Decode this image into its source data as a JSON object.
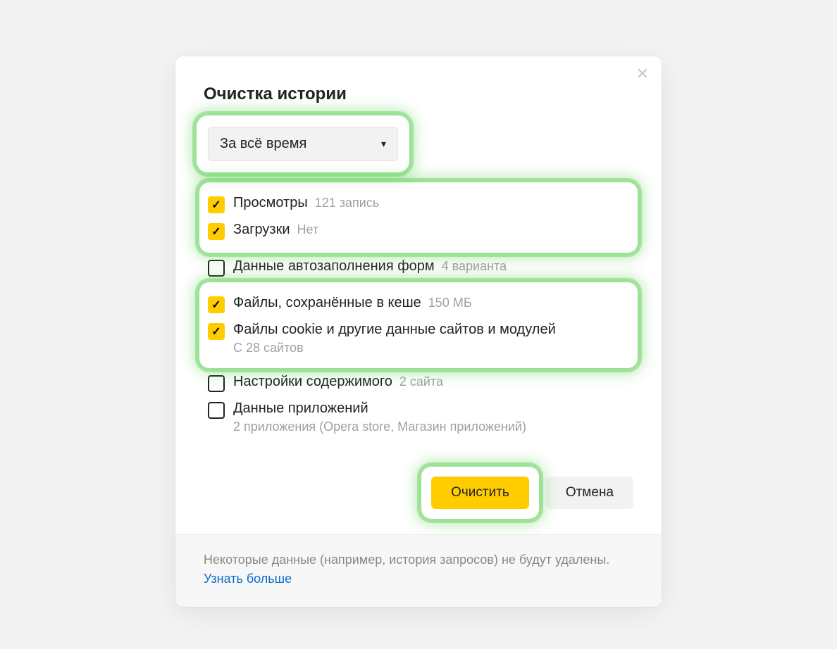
{
  "dialog": {
    "title": "Очистка истории",
    "time_range_selected": "За всё время",
    "options": {
      "history": {
        "label": "Просмотры",
        "sub": "121 запись",
        "checked": true
      },
      "downloads": {
        "label": "Загрузки",
        "sub": "Нет",
        "checked": true
      },
      "autofill": {
        "label": "Данные автозаполнения форм",
        "sub": "4 варианта",
        "checked": false
      },
      "cache": {
        "label": "Файлы, сохранённые в кеше",
        "sub": "150 МБ",
        "checked": true
      },
      "cookies": {
        "label": "Файлы cookie и другие данные сайтов и модулей",
        "sub_under": "С 28 сайтов",
        "checked": true
      },
      "content": {
        "label": "Настройки содержимого",
        "sub": "2 сайта",
        "checked": false
      },
      "appdata": {
        "label": "Данные приложений",
        "sub_under": "2 приложения (Opera store, Магазин приложений)",
        "checked": false
      }
    },
    "buttons": {
      "clear": "Очистить",
      "cancel": "Отмена"
    },
    "footer": {
      "note": "Некоторые данные (например, история запросов) не будут удалены.",
      "learn_more": "Узнать больше"
    }
  }
}
